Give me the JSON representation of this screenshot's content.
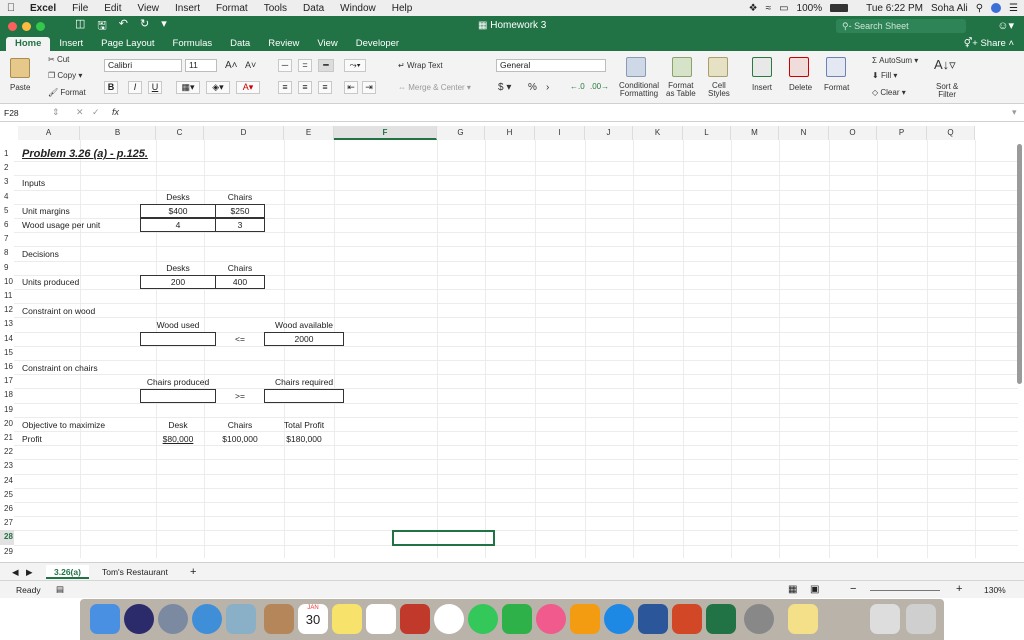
{
  "menubar": {
    "app": "Excel",
    "items": [
      "File",
      "Edit",
      "View",
      "Insert",
      "Format",
      "Tools",
      "Data",
      "Window",
      "Help"
    ],
    "battery": "100%",
    "clock": "Tue 6:22 PM",
    "user": "Soha Ali"
  },
  "titlebar": {
    "doc_title": "Homework 3",
    "search_placeholder": "Search Sheet"
  },
  "tabs": [
    "Home",
    "Insert",
    "Page Layout",
    "Formulas",
    "Data",
    "Review",
    "View",
    "Developer"
  ],
  "share_label": "Share",
  "ribbon": {
    "paste": "Paste",
    "cut": "Cut",
    "copy": "Copy",
    "format_painter": "Format",
    "font_name": "Calibri",
    "font_size": "11",
    "wrap_text": "Wrap Text",
    "merge_center": "Merge & Center",
    "number_format": "General",
    "conditional_formatting": "Conditional Formatting",
    "conditional_1": "Conditional",
    "conditional_2": "Formatting",
    "format_as_table_1": "Format",
    "format_as_table_2": "as Table",
    "cell_styles_1": "Cell",
    "cell_styles_2": "Styles",
    "insert": "Insert",
    "delete": "Delete",
    "format": "Format",
    "autosum": "AutoSum",
    "fill": "Fill",
    "clear": "Clear",
    "sort_filter_1": "Sort &",
    "sort_filter_2": "Filter"
  },
  "formula_bar": {
    "name_box": "F28",
    "fx": "fx",
    "content": ""
  },
  "columns": [
    "A",
    "B",
    "C",
    "D",
    "E",
    "F",
    "G",
    "H",
    "I",
    "J",
    "K",
    "L",
    "M",
    "N",
    "O",
    "P",
    "Q"
  ],
  "rows": [
    "1",
    "2",
    "3",
    "4",
    "5",
    "6",
    "7",
    "8",
    "9",
    "10",
    "11",
    "12",
    "13",
    "14",
    "15",
    "16",
    "17",
    "18",
    "19",
    "20",
    "21",
    "22",
    "23",
    "24",
    "25",
    "26",
    "27",
    "28",
    "29"
  ],
  "cells": {
    "A1": "Problem 3.26 (a) - p.125.",
    "A3": "Inputs",
    "B4": "Desks",
    "C4": "Chairs",
    "A5": "Unit margins",
    "B5": "$400",
    "C5": "$250",
    "A6": "Wood usage per unit",
    "B6": "4",
    "C6": "3",
    "A8": "Decisions",
    "B9": "Desks",
    "C9": "Chairs",
    "A10": "Units produced",
    "B10": "200",
    "C10": "400",
    "A12": "Constraint on wood",
    "B13": "Wood used",
    "D13": "Wood available",
    "C14": "<=",
    "D14": "2000",
    "A16": "Constraint on chairs",
    "B17": "Chairs produced",
    "D17": "Chairs required",
    "C18": ">=",
    "A20": "Objective to maximize",
    "B20": "Desk",
    "C20": "Chairs",
    "D20": "Total Profit",
    "A21": "Profit",
    "B21": "$80,000",
    "C21": "$100,000",
    "D21": "$180,000"
  },
  "sheets": [
    "3.26(a)",
    "Tom's Restaurant"
  ],
  "status": {
    "ready": "Ready",
    "zoom": "130%"
  },
  "dock": {
    "calendar_month": "JAN",
    "calendar_day": "30"
  },
  "colors": {
    "excel_green": "#217346",
    "selection": "#217346"
  }
}
